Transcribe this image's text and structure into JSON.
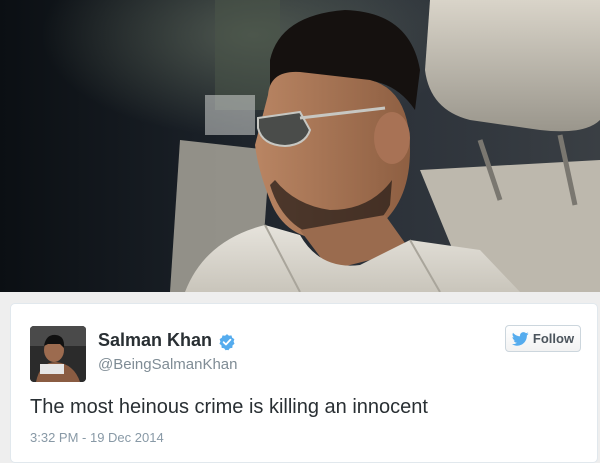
{
  "tweet": {
    "author_name": "Salman Khan",
    "author_handle": "@BeingSalmanKhan",
    "verified": true,
    "text": "The most heinous crime is killing an innocent",
    "timestamp": "3:32 PM - 19 Dec 2014",
    "follow_label": "Follow"
  },
  "icons": {
    "verified": "verified-badge-icon",
    "follow": "twitter-bird-icon"
  },
  "colors": {
    "verified_badge": "#55acee",
    "follow_bird": "#55acee",
    "text_primary": "#292f33",
    "text_secondary": "#8899a6"
  }
}
